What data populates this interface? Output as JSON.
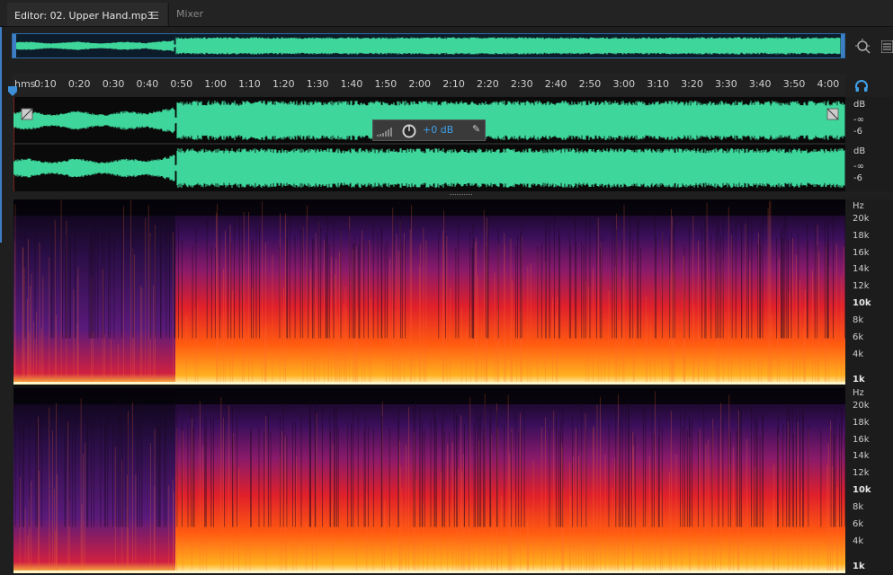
{
  "tabs": [
    {
      "label": "Editor: 02. Upper Hand.mp3",
      "active": true,
      "menu_icon": "hamburger-icon"
    },
    {
      "label": "Mixer",
      "active": false
    }
  ],
  "ruler": {
    "unit": "hms",
    "labels": [
      "0:10",
      "0:20",
      "0:30",
      "0:40",
      "0:50",
      "1:00",
      "1:10",
      "1:20",
      "1:30",
      "1:40",
      "1:50",
      "2:00",
      "2:10",
      "2:20",
      "2:30",
      "2:40",
      "2:50",
      "3:00",
      "3:10",
      "3:20",
      "3:30",
      "3:40",
      "3:50",
      "4:00"
    ]
  },
  "amplitude_scale": {
    "channels": [
      {
        "unit": "dB",
        "labels": [
          "-∞",
          "-6"
        ]
      },
      {
        "unit": "dB",
        "labels": [
          "-∞",
          "-6"
        ]
      }
    ]
  },
  "hud": {
    "value": "+0 dB"
  },
  "frequency_scale": {
    "channels": [
      {
        "unit": "Hz",
        "labels": [
          "20k",
          "18k",
          "16k",
          "14k",
          "12k",
          "10k",
          "8k",
          "6k",
          "4k",
          "1k"
        ]
      },
      {
        "unit": "Hz",
        "labels": [
          "20k",
          "18k",
          "16k",
          "14k",
          "12k",
          "10k",
          "8k",
          "6k",
          "4k",
          "1k"
        ]
      }
    ]
  },
  "colors": {
    "waveform": "#3ed69a",
    "accent": "#3fa0e8"
  }
}
